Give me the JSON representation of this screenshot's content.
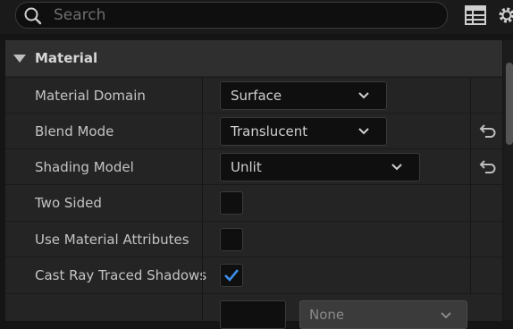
{
  "search": {
    "placeholder": "Search"
  },
  "section": {
    "title": "Material"
  },
  "rows": [
    {
      "label": "Material Domain",
      "value": "Surface"
    },
    {
      "label": "Blend Mode",
      "value": "Translucent"
    },
    {
      "label": "Shading Model",
      "value": "Unlit"
    },
    {
      "label": "Two Sided",
      "checked": false
    },
    {
      "label": "Use Material Attributes",
      "checked": false
    },
    {
      "label": "Cast Ray Traced Shadows",
      "checked": true
    },
    {
      "label": "",
      "value": "None"
    }
  ],
  "colors": {
    "check": "#3b8eea",
    "background": "#242424",
    "header": "#2f2f2f"
  },
  "icons": [
    "search-icon",
    "table-view-icon",
    "settings-gear-icon",
    "collapse-arrow-icon",
    "chevron-down-icon",
    "reset-to-default-icon",
    "checkmark-icon"
  ]
}
